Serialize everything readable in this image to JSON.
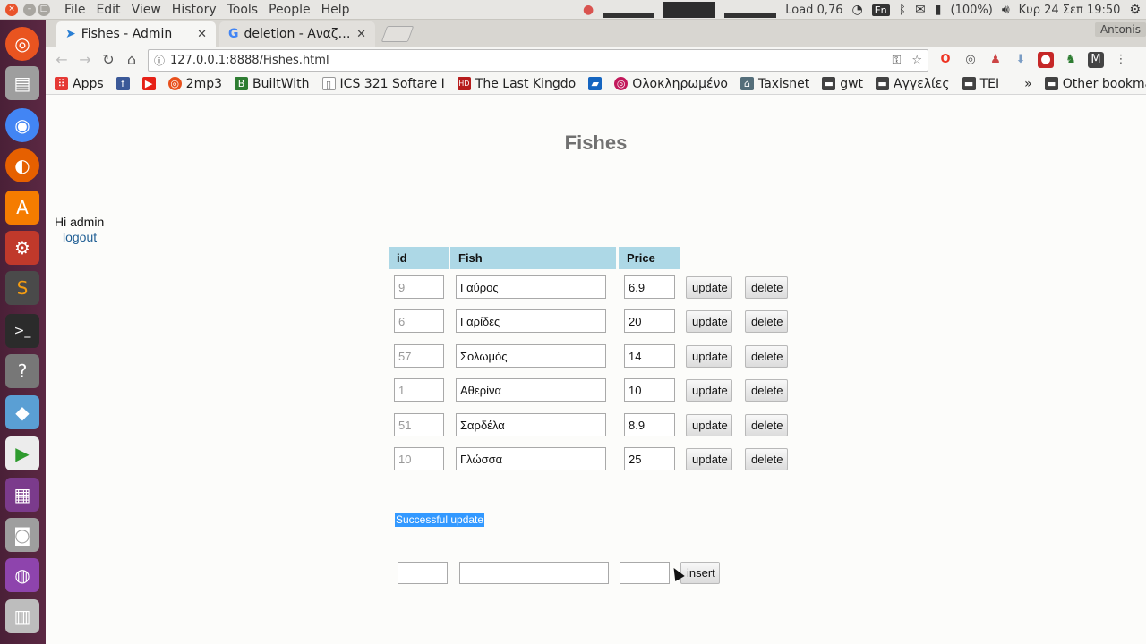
{
  "system": {
    "menu": [
      "File",
      "Edit",
      "View",
      "History",
      "Tools",
      "People",
      "Help"
    ],
    "tray": {
      "load": "Load 0,76",
      "keyboard": "En",
      "battery": "(100%)",
      "datetime": "Κυρ 24 Σεπ 19:50"
    }
  },
  "browser": {
    "tabs": [
      {
        "title": "Fishes - Admin"
      },
      {
        "title": "deletion - Αναζήτηση"
      }
    ],
    "profile": "Antonis",
    "url": "127.0.0.1:8888/Fishes.html",
    "bookmarks": [
      {
        "label": "Apps",
        "icon": "apps-icon",
        "color": "#e53935"
      },
      {
        "label": "",
        "icon": "facebook-icon",
        "color": "#3b5998"
      },
      {
        "label": "",
        "icon": "youtube-icon",
        "color": "#e62117"
      },
      {
        "label": "2mp3",
        "icon": "2mp3-icon",
        "color": "#e8501c"
      },
      {
        "label": "BuiltWith",
        "icon": "builtwith-icon",
        "color": "#2e7d32"
      },
      {
        "label": "ICS 321 Softare I",
        "icon": "page-icon",
        "color": "#888888"
      },
      {
        "label": "The Last Kingdo",
        "icon": "hd-video-icon",
        "color": "#b71c1c"
      },
      {
        "label": "",
        "icon": "bookmark-icon",
        "color": "#1565c0"
      },
      {
        "label": "Ολοκληρωμένο",
        "icon": "site-icon",
        "color": "#c2185b"
      },
      {
        "label": "Taxisnet",
        "icon": "taxisnet-icon",
        "color": "#546e7a"
      },
      {
        "label": "gwt",
        "icon": "folder-icon",
        "color": "#424242"
      },
      {
        "label": "Αγγελίες",
        "icon": "folder-icon",
        "color": "#424242"
      },
      {
        "label": "TEI",
        "icon": "folder-icon",
        "color": "#424242"
      }
    ],
    "bookmarks_overflow": "»",
    "other_bookmarks": "Other bookmarks"
  },
  "page": {
    "title": "Fishes",
    "greeting": "Hi admin",
    "logout": "logout",
    "columns": [
      "id",
      "Fish",
      "Price"
    ],
    "rows": [
      {
        "id": "9",
        "fish": "Γαύρος",
        "price": "6.9"
      },
      {
        "id": "6",
        "fish": "Γαρίδες",
        "price": "20"
      },
      {
        "id": "57",
        "fish": "Σολωμός",
        "price": "14"
      },
      {
        "id": "1",
        "fish": "Αθερίνα",
        "price": "10"
      },
      {
        "id": "51",
        "fish": "Σαρδέλα",
        "price": "8.9"
      },
      {
        "id": "10",
        "fish": "Γλώσσα",
        "price": "25"
      }
    ],
    "update_label": "update",
    "delete_label": "delete",
    "status": "Successful update",
    "insert_label": "insert",
    "highlight_color": "#add8e6"
  }
}
